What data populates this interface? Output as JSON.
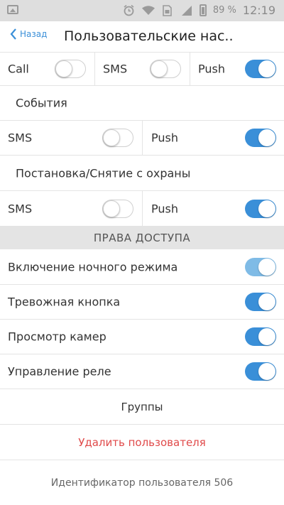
{
  "status_bar": {
    "battery": "89 %",
    "time": "12:19",
    "icons": [
      "image-icon",
      "alarm-icon",
      "wifi-icon",
      "sim-icon",
      "signal-icon",
      "battery-icon"
    ]
  },
  "header": {
    "back_label": "Назад",
    "title": "Пользовательские нас.."
  },
  "top_channels": [
    {
      "label": "Call",
      "on": false
    },
    {
      "label": "SMS",
      "on": false
    },
    {
      "label": "Push",
      "on": true
    }
  ],
  "events_section": {
    "title": "События",
    "channels": [
      {
        "label": "SMS",
        "on": false
      },
      {
        "label": "Push",
        "on": true
      }
    ]
  },
  "arming_section": {
    "title": "Постановка/Снятие с охраны",
    "channels": [
      {
        "label": "SMS",
        "on": false
      },
      {
        "label": "Push",
        "on": true
      }
    ]
  },
  "access_rights": {
    "header": "ПРАВА ДОСТУПА",
    "items": [
      {
        "label": "Включение ночного режима",
        "on": true
      },
      {
        "label": "Тревожная кнопка",
        "on": true
      },
      {
        "label": "Просмотр камер",
        "on": true
      },
      {
        "label": "Управление реле",
        "on": true
      }
    ]
  },
  "groups_label": "Группы",
  "delete_label": "Удалить пользователя",
  "user_id_label": "Идентификатор пользователя 506",
  "colors": {
    "accent": "#3a8fd8",
    "danger": "#e04a4a",
    "separator": "#e4e4e4"
  }
}
